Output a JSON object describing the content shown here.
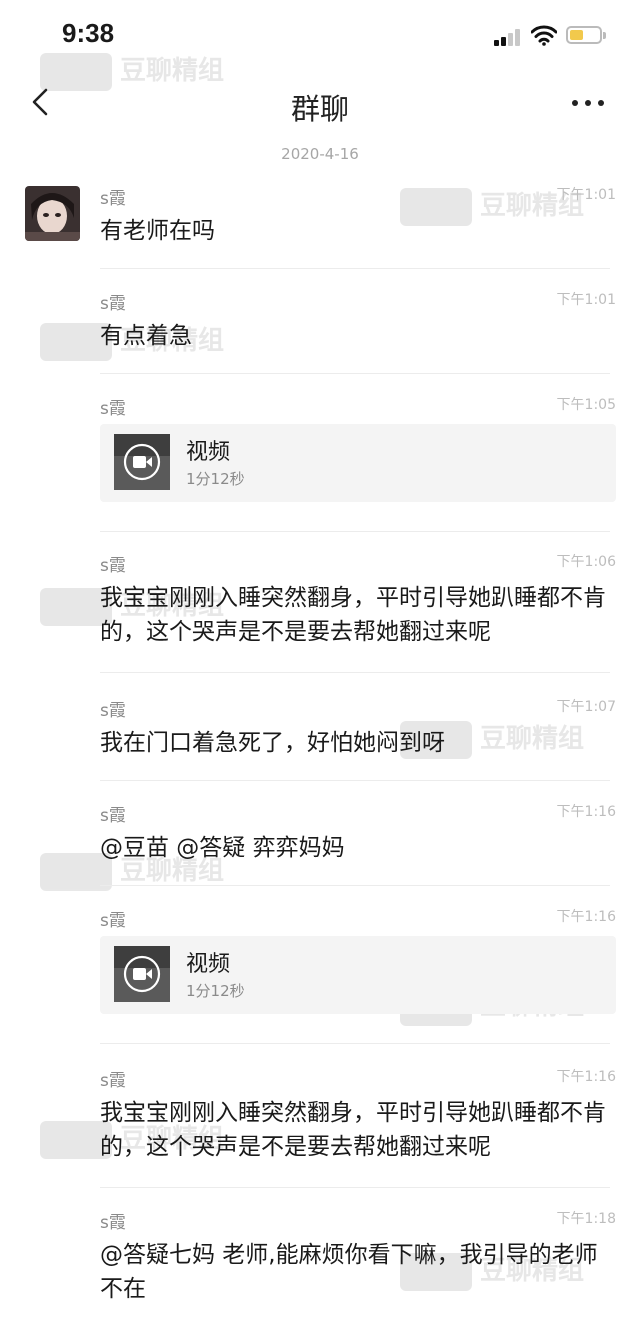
{
  "status_bar": {
    "time": "9:38"
  },
  "nav": {
    "title": "群聊"
  },
  "date_divider": "2020-4-16",
  "messages": [
    {
      "name": "s霞",
      "time": "下午1:01",
      "text": "有老师在吗"
    },
    {
      "name": "s霞",
      "time": "下午1:01",
      "text": "有点着急"
    },
    {
      "name": "s霞",
      "time": "下午1:05",
      "video_title": "视频",
      "video_duration": "1分12秒"
    },
    {
      "name": "s霞",
      "time": "下午1:06",
      "text": "我宝宝刚刚入睡突然翻身，平时引导她趴睡都不肯的，这个哭声是不是要去帮她翻过来呢"
    },
    {
      "name": "s霞",
      "time": "下午1:07",
      "text": "我在门口着急死了，好怕她闷到呀"
    },
    {
      "name": "s霞",
      "time": "下午1:16",
      "text": "@豆苗 @答疑 弈弈妈妈"
    },
    {
      "name": "s霞",
      "time": "下午1:16",
      "video_title": "视频",
      "video_duration": "1分12秒"
    },
    {
      "name": "s霞",
      "time": "下午1:16",
      "text": "我宝宝刚刚入睡突然翻身，平时引导她趴睡都不肯的，这个哭声是不是要去帮她翻过来呢"
    },
    {
      "name": "s霞",
      "time": "下午1:18",
      "text": "@答疑七妈 老师,能麻烦你看下嘛，我引导的老师不在"
    }
  ],
  "icons": {
    "back": "chevron-left-icon",
    "more": "more-dots-icon",
    "video": "video-camera-icon",
    "signal": "cellular-signal-icon",
    "wifi": "wifi-icon",
    "battery": "battery-icon"
  }
}
